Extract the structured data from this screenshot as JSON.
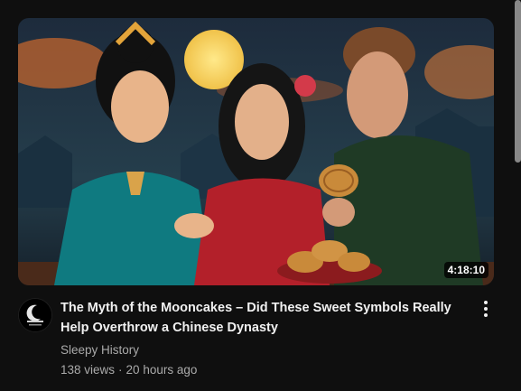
{
  "video": {
    "title": "The Myth of the Mooncakes – Did These Sweet Symbols Really Help Overthrow a Chinese Dynasty",
    "duration": "4:18:10",
    "channel": "Sleepy History",
    "views": "138 views",
    "age": "20 hours ago",
    "separator": "·",
    "avatar_text": "Sleepy History"
  },
  "icons": {
    "menu": "more-vert-icon",
    "avatar": "channel-avatar-icon"
  },
  "colors": {
    "background": "#0f0f0f",
    "title": "#f1f1f1",
    "secondary_text": "#aaaaaa"
  }
}
